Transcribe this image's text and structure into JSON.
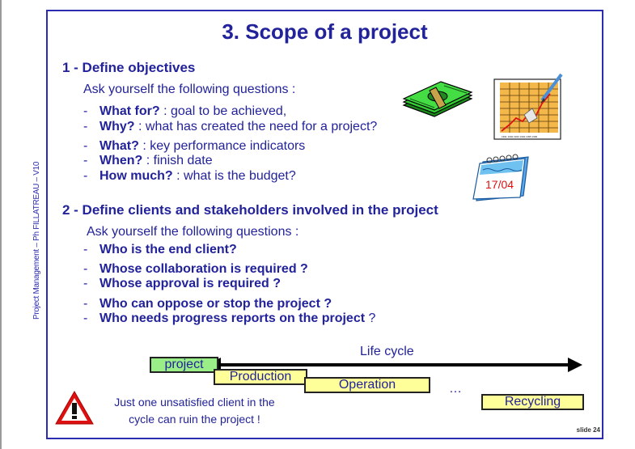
{
  "side_text": "Project Management – Ph FILLATREAU – V10",
  "title": "3. Scope of a project",
  "section1": {
    "heading": "1 - Define objectives",
    "intro": "Ask yourself the following questions :",
    "items": [
      {
        "q": "What for?",
        "rest": " : goal to be achieved,"
      },
      {
        "q": "Why?",
        "rest": " : what has created the need for a project?"
      },
      {
        "q": "What?",
        "rest": " : key performance indicators"
      },
      {
        "q": "When?",
        "rest": " : finish date"
      },
      {
        "q": "How much?",
        "rest": " : what is the budget?"
      }
    ]
  },
  "section2": {
    "heading": "2 - Define clients and stakeholders involved in the project",
    "intro": "Ask yourself the following questions :",
    "items": [
      {
        "q": "Who is the end client?",
        "rest": ""
      },
      {
        "q": "Whose collaboration is required ?",
        "rest": ""
      },
      {
        "q": "Whose approval is required ?",
        "rest": ""
      },
      {
        "q": "Who can oppose or stop the project ?",
        "rest": ""
      },
      {
        "q": "Who needs progress reports on the project",
        "rest": " ?"
      }
    ]
  },
  "dash": "-",
  "calendar_date": "17/04",
  "lifecycle": {
    "label": "Life cycle",
    "project": "project",
    "production": "Production",
    "operation": "Operation",
    "ellipsis": "…",
    "recycling": "Recycling"
  },
  "warning": {
    "line1": "Just one unsatisfied client in the",
    "line2": "cycle can ruin the project !"
  },
  "slide_number": "slide 24",
  "colors": {
    "text": "#22229a",
    "frame": "#2c2cb0",
    "project_box": "#99ee88",
    "phase_box": "#ffff99",
    "warning_red": "#cc1111"
  }
}
